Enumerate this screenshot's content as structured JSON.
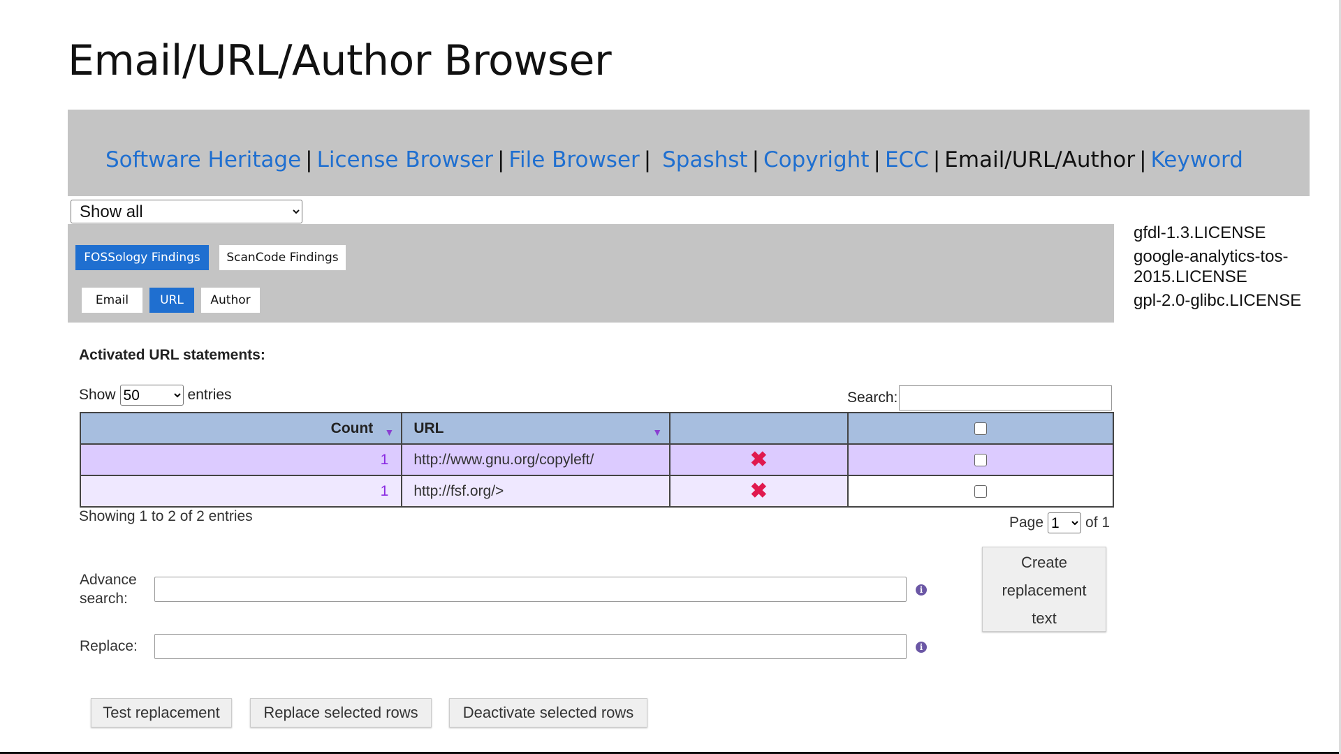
{
  "page": {
    "title": "Email/URL/Author Browser"
  },
  "nav": {
    "links": [
      "Software Heritage",
      "License Browser",
      "File Browser",
      "Spashst",
      "Copyright",
      "ECC"
    ],
    "current": "Email/URL/Author",
    "last_link": "Keyword",
    "separator": "|"
  },
  "filter": {
    "selected": "Show all"
  },
  "findings_tabs": {
    "fossology": "FOSSology Findings",
    "scancode": "ScanCode Findings"
  },
  "type_tabs": {
    "email": "Email",
    "url": "URL",
    "author": "Author",
    "active": "URL"
  },
  "files": [
    "gfdl-1.3.LICENSE",
    "google-analytics-tos-2015.LICENSE",
    "gpl-2.0-glibc.LICENSE"
  ],
  "section": {
    "title": "Activated URL statements:"
  },
  "length": {
    "show_label": "Show",
    "value": "50",
    "entries_label": "entries"
  },
  "search": {
    "label": "Search:",
    "value": ""
  },
  "table": {
    "columns": {
      "count": "Count",
      "url": "URL"
    },
    "rows": [
      {
        "count": "1",
        "url": "http://www.gnu.org/copyleft/"
      },
      {
        "count": "1",
        "url": "http://fsf.org/>"
      }
    ]
  },
  "info": {
    "text": "Showing 1 to 2 of 2 entries"
  },
  "pager": {
    "page_label": "Page",
    "current": "1",
    "of_label": "of 1"
  },
  "advance": {
    "label_line1": "Advance",
    "label_line2": "search:",
    "value": ""
  },
  "replace": {
    "label": "Replace:",
    "value": ""
  },
  "create_button": {
    "line1": "Create",
    "line2": "replacement",
    "line3": "text"
  },
  "actions": {
    "test": "Test replacement",
    "replace_rows": "Replace selected rows",
    "deactivate_rows": "Deactivate selected rows"
  },
  "colors": {
    "accent": "#1f6fd0",
    "panel": "#c4c4c4",
    "row_odd": "#dccbff",
    "row_even": "#efe8ff",
    "delete": "#e0194e"
  }
}
